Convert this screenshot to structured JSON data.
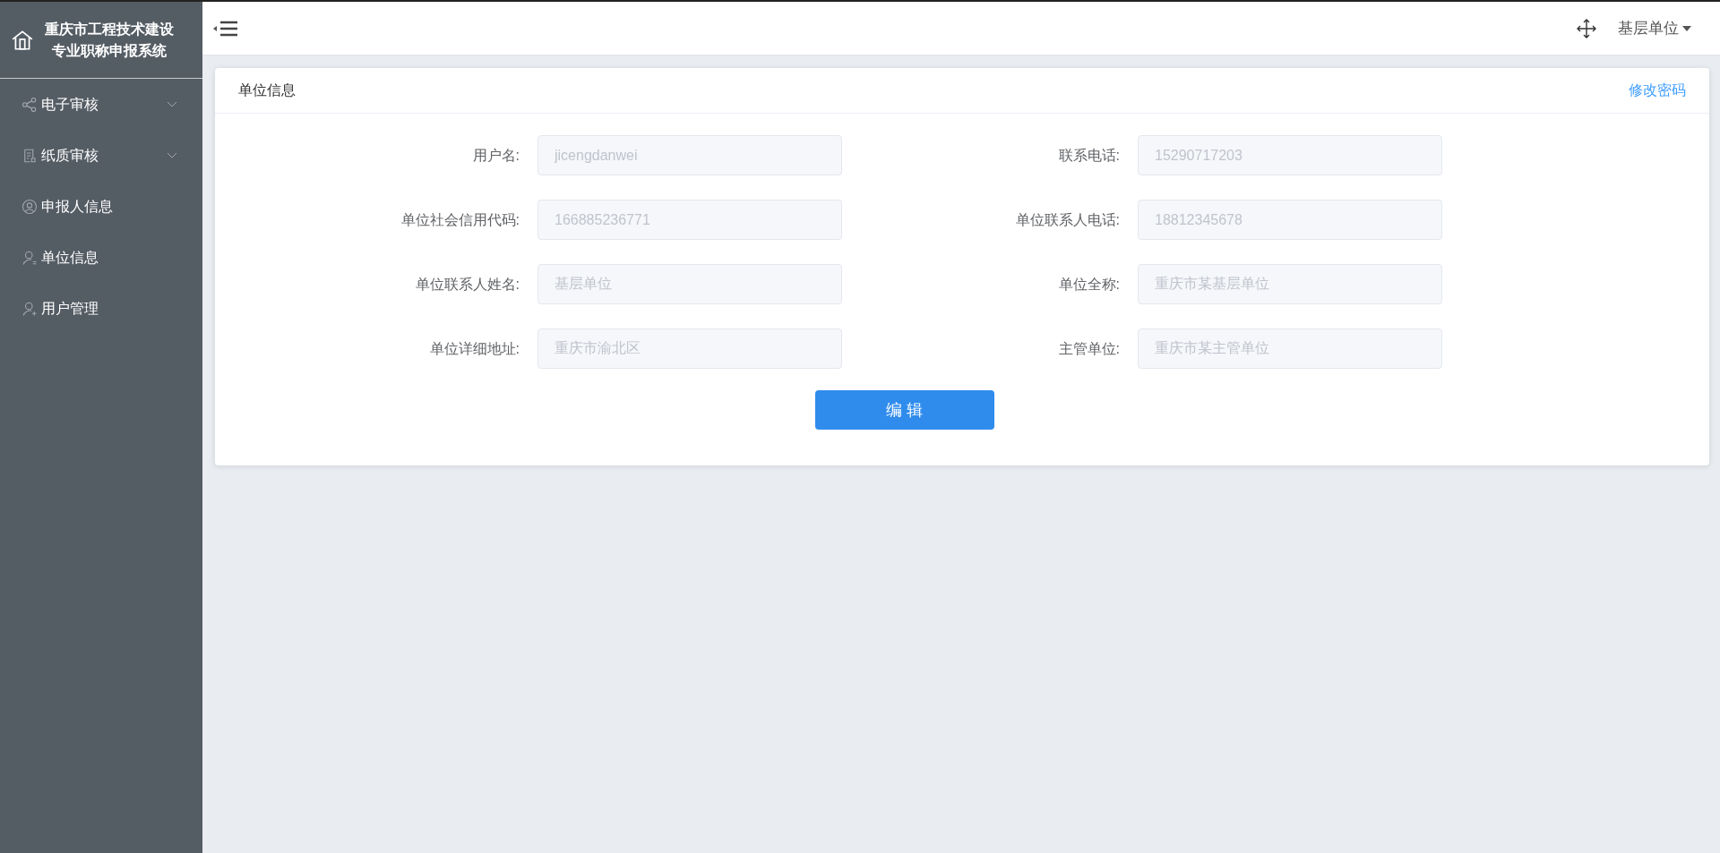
{
  "sidebar": {
    "title_lines": [
      "重庆市工程技术建设",
      "专业职称申报系统"
    ],
    "items": [
      {
        "label": "电子审核",
        "kind": "submenu"
      },
      {
        "label": "纸质审核",
        "kind": "submenu"
      },
      {
        "label": "申报人信息",
        "kind": "link"
      },
      {
        "label": "单位信息",
        "kind": "link"
      },
      {
        "label": "用户管理",
        "kind": "link"
      }
    ]
  },
  "header": {
    "user": "基层单位"
  },
  "card": {
    "title": "单位信息",
    "link": "修改密码",
    "fields": [
      {
        "label": "用户名:",
        "value": "jicengdanwei"
      },
      {
        "label": "联系电话:",
        "value": "15290717203"
      },
      {
        "label": "单位社会信用代码:",
        "value": "166885236771"
      },
      {
        "label": "单位联系人电话:",
        "value": "18812345678"
      },
      {
        "label": "单位联系人姓名:",
        "value": "基层单位"
      },
      {
        "label": "单位全称:",
        "value": "重庆市某基层单位"
      },
      {
        "label": "单位详细地址:",
        "value": "重庆市渝北区"
      },
      {
        "label": "主管单位:",
        "value": "重庆市某主管单位"
      }
    ],
    "button": "编 辑"
  }
}
